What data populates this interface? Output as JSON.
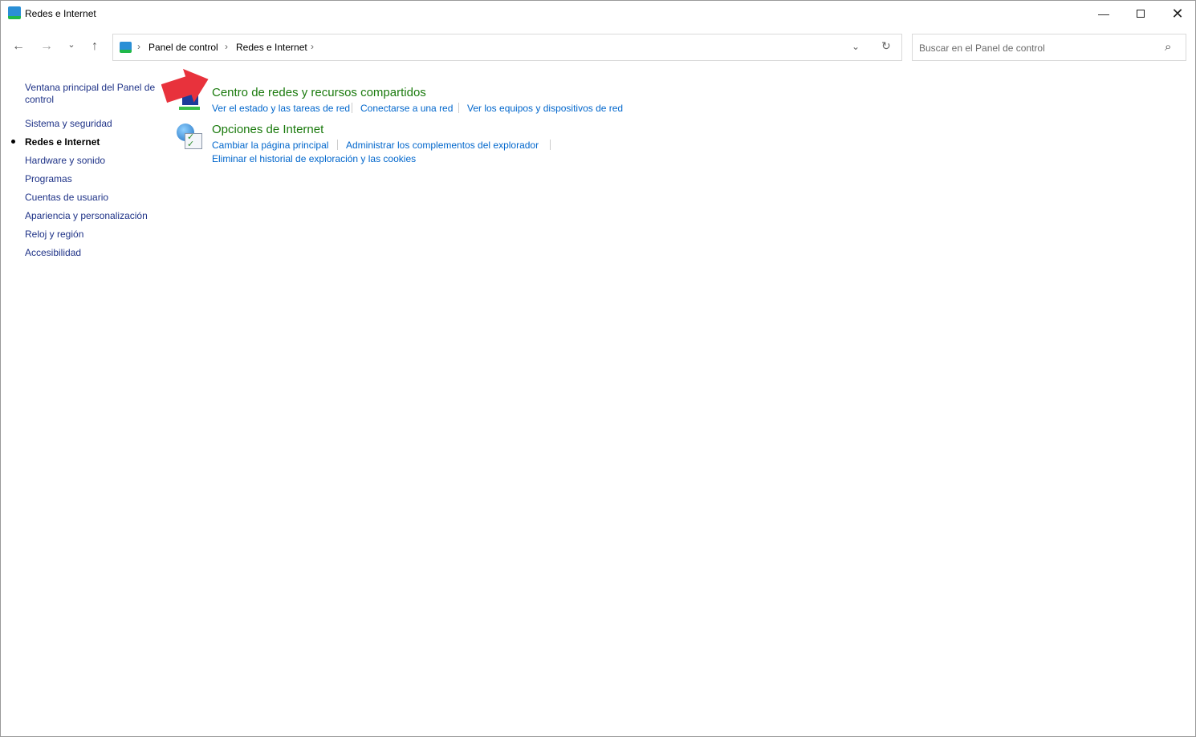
{
  "window": {
    "title": "Redes e Internet",
    "minimize_icon": "minimize-icon",
    "maximize_icon": "maximize-icon",
    "close_icon": "close-icon"
  },
  "nav": {
    "back": "←",
    "forward": "→",
    "recent": "⌄",
    "up": "↑"
  },
  "address": {
    "crumbs": [
      "Panel de control",
      "Redes e Internet"
    ],
    "separator": "›",
    "dropdown": "⌄",
    "refresh": "↻"
  },
  "search": {
    "placeholder": "Buscar en el Panel de control",
    "icon": "⌕"
  },
  "sidebar": {
    "items": [
      {
        "label": "Ventana principal del Panel de control"
      },
      {
        "label": "Sistema y seguridad"
      },
      {
        "label": "Redes e Internet",
        "active": true
      },
      {
        "label": "Hardware y sonido"
      },
      {
        "label": "Programas"
      },
      {
        "label": "Cuentas de usuario"
      },
      {
        "label": "Apariencia y personalización"
      },
      {
        "label": "Reloj y región"
      },
      {
        "label": "Accesibilidad"
      }
    ]
  },
  "categories": [
    {
      "title": "Centro de redes y recursos compartidos",
      "icon": "network-center-icon",
      "links": [
        "Ver el estado y las tareas de red",
        "Conectarse a una red",
        "Ver los equipos y dispositivos de red"
      ]
    },
    {
      "title": "Opciones de Internet",
      "icon": "internet-options-icon",
      "links": [
        "Cambiar la página principal",
        "Administrar los complementos del explorador",
        "Eliminar el historial de exploración y las cookies"
      ]
    }
  ],
  "colors": {
    "category_title": "#1a7a0d",
    "link": "#0066cc",
    "sidebar_link": "#1e3287",
    "annotation_arrow": "#e8323c"
  }
}
